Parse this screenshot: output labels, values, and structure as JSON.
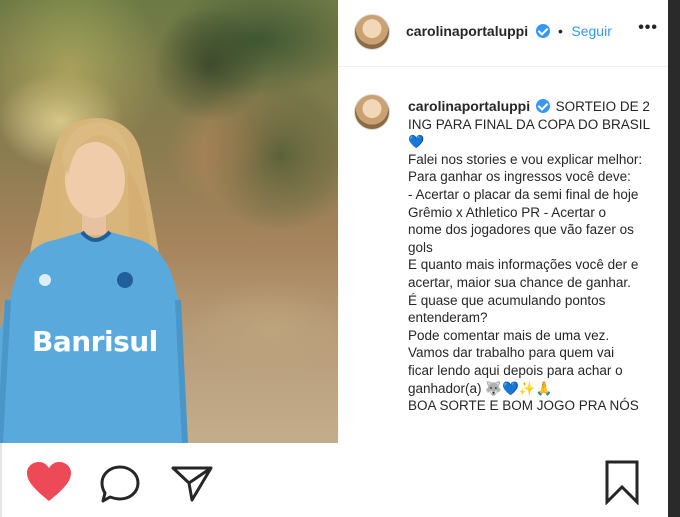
{
  "header": {
    "username": "carolinaportaluppi",
    "dot": "•",
    "follow_label": "Seguir",
    "more_label": "•••"
  },
  "post": {
    "author": "carolinaportaluppi",
    "caption_lines": [
      "SORTEIO DE 2",
      "ING PARA FINAL DA COPA DO BRASIL",
      "💙",
      "Falei nos stories e vou explicar melhor:",
      "Para ganhar os ingressos você deve:",
      "- Acertar o placar da semi final de hoje",
      "Grêmio x Athletico PR - Acertar o",
      "nome dos jogadores que vão fazer os",
      "gols",
      "E quanto mais informações você der e",
      "acertar, maior sua chance de ganhar.",
      "É quase que acumulando pontos",
      "entenderam?",
      "Pode comentar mais de uma vez.",
      "Vamos dar trabalho para quem vai",
      "ficar lendo aqui depois para achar o",
      "ganhador(a) 🐺💙✨🙏",
      "BOA SORTE E BOM JOGO PRA NÓS"
    ]
  },
  "photo": {
    "shirt_text": "Banrisul"
  },
  "colors": {
    "verified": "#3897f0",
    "like": "#ed4956",
    "shirt": "#5aa9dc"
  },
  "icons": [
    "heart-icon",
    "comment-icon",
    "share-icon",
    "bookmark-icon",
    "verified-badge-icon",
    "more-options-icon"
  ]
}
